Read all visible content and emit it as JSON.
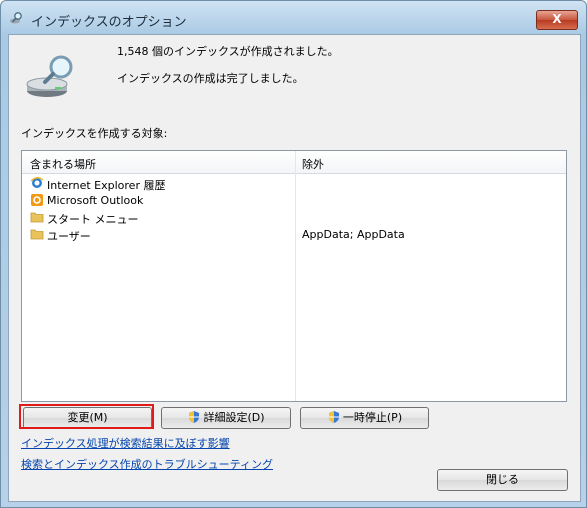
{
  "window": {
    "title": "インデックスのオプション",
    "close_label": "X"
  },
  "status": {
    "line1": "1,548 個のインデックスが作成されました。",
    "line2": "インデックスの作成は完了しました。"
  },
  "section_label": "インデックスを作成する対象:",
  "table": {
    "headers": {
      "location": "含まれる場所",
      "exclude": "除外"
    },
    "rows": [
      {
        "icon": "internet-explorer-icon",
        "location": "Internet Explorer 履歴",
        "exclude": ""
      },
      {
        "icon": "outlook-icon",
        "location": "Microsoft Outlook",
        "exclude": ""
      },
      {
        "icon": "folder-icon",
        "location": "スタート メニュー",
        "exclude": ""
      },
      {
        "icon": "folder-icon",
        "location": "ユーザー",
        "exclude": "AppData; AppData"
      }
    ]
  },
  "buttons": {
    "modify": "変更(M)",
    "advanced": "詳細設定(D)",
    "pause": "一時停止(P)",
    "close": "閉じる"
  },
  "links": {
    "impact": "インデックス処理が検索結果に及ぼす影響",
    "troubleshoot": "検索とインデックス作成のトラブルシューティング"
  },
  "colors": {
    "highlight": "#e11a1a",
    "link": "#0645ad"
  }
}
